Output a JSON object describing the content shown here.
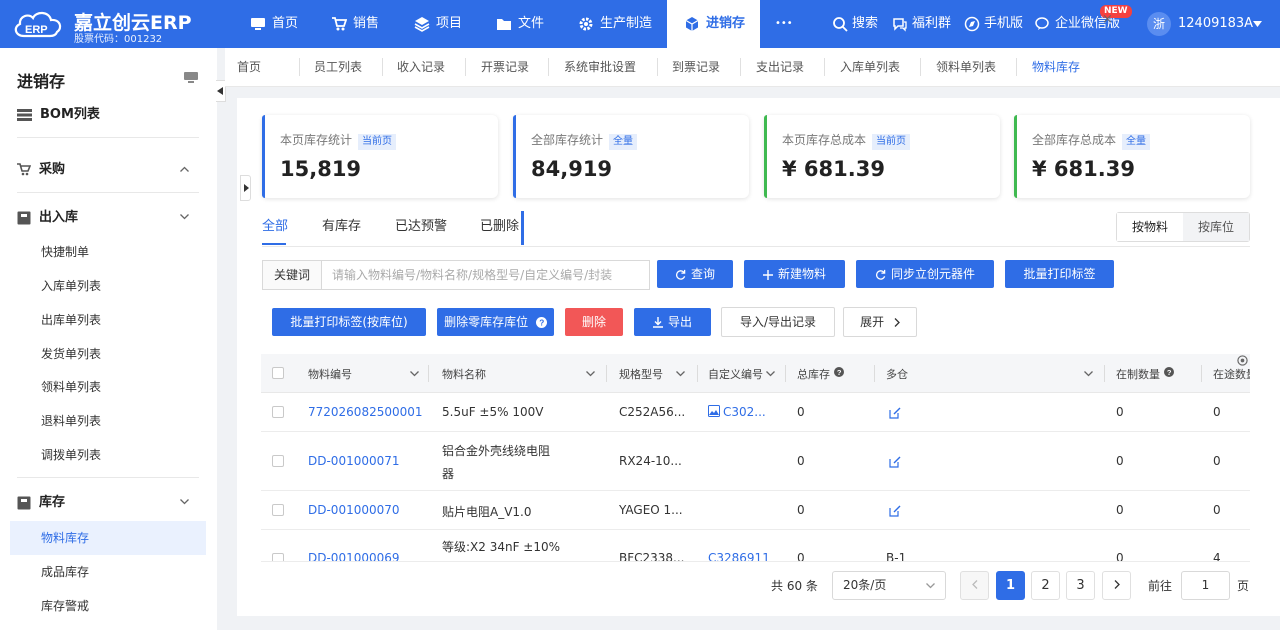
{
  "brand": {
    "name": "嘉立创云ERP",
    "subtitle": "股票代码：001232",
    "logo_text": "ERP"
  },
  "nav": [
    {
      "label": "首页",
      "icon": "monitor-icon"
    },
    {
      "label": "销售",
      "icon": "cart-icon"
    },
    {
      "label": "项目",
      "icon": "layers-icon"
    },
    {
      "label": "文件",
      "icon": "folder-icon"
    },
    {
      "label": "生产制造",
      "icon": "gear-icon"
    },
    {
      "label": "进销存",
      "icon": "cube-icon",
      "active": true
    },
    {
      "label": "•••",
      "icon": "more-icon"
    }
  ],
  "tools": {
    "search": "搜索",
    "welfare": "福利群",
    "mobile": "手机版",
    "wechat": "企业微信版",
    "new_badge": "NEW"
  },
  "user": {
    "avatar": "浙",
    "name": "12409183A"
  },
  "sidebar": {
    "title": "进销存",
    "bom": "BOM列表",
    "purchase": "采购",
    "inout": "出入库",
    "inout_items": [
      "快捷制单",
      "入库单列表",
      "出库单列表",
      "发货单列表",
      "领料单列表",
      "退料单列表",
      "调拨单列表"
    ],
    "stock": "库存",
    "stock_items": [
      "物料库存",
      "成品库存",
      "库存警戒"
    ]
  },
  "tabs": [
    "首页",
    "员工列表",
    "收入记录",
    "开票记录",
    "系统审批设置",
    "到票记录",
    "支出记录",
    "入库单列表",
    "领料单列表",
    "物料库存"
  ],
  "tab_close": "×",
  "cards": [
    {
      "label": "本页库存统计",
      "badge": "当前页",
      "value": "15,819",
      "color": "#2f6de6"
    },
    {
      "label": "全部库存统计",
      "badge": "全量",
      "value": "84,919",
      "color": "#2f6de6"
    },
    {
      "label": "本页库存总成本",
      "badge": "当前页",
      "value": "¥ 681.39",
      "color": "#3fb950"
    },
    {
      "label": "全部库存总成本",
      "badge": "全量",
      "value": "¥ 681.39",
      "color": "#3fb950"
    }
  ],
  "filter_tabs": [
    "全部",
    "有库存",
    "已达预警",
    "已删除"
  ],
  "view_toggle": [
    "按物料",
    "按库位"
  ],
  "search": {
    "label": "关键词",
    "placeholder": "请输入物料编号/物料名称/规格型号/自定义编号/封装"
  },
  "buttons": {
    "query": "查询",
    "new_material": "新建物料",
    "sync": "同步立创元器件",
    "batch_print": "批量打印标签",
    "batch_print_loc": "批量打印标签(按库位)",
    "delete_zero": "删除零库存库位",
    "delete": "删除",
    "export": "导出",
    "import_export": "导入/导出记录",
    "expand": "展开"
  },
  "columns": [
    "物料编号",
    "物料名称",
    "规格型号",
    "自定义编号",
    "总库存",
    "多仓",
    "在制数量",
    "在途数量"
  ],
  "rows": [
    {
      "code": "772026082500001",
      "name": [
        "5.5uF ±5% 100V"
      ],
      "spec": "C252A56...",
      "custom": "C302...",
      "total": "0",
      "multi": "",
      "making": "0",
      "transit": "0"
    },
    {
      "code": "DD-001000071",
      "name": [
        "铝合金外壳线绕电阻",
        "器"
      ],
      "spec": "RX24-10...",
      "custom": "",
      "total": "0",
      "multi": "",
      "making": "0",
      "transit": "0"
    },
    {
      "code": "DD-001000070",
      "name": [
        "贴片电阻A_V1.0"
      ],
      "spec": "YAGEO 1...",
      "custom": "",
      "total": "0",
      "multi": "",
      "making": "0",
      "transit": "0"
    },
    {
      "code": "DD-001000069",
      "name": [
        "等级:X2 34nF ±10%"
      ],
      "spec": "BFC2338...",
      "custom": "C3286911",
      "total": "0",
      "multi": "B-1",
      "making": "0",
      "transit": "4"
    }
  ],
  "pager": {
    "total": "共 60 条",
    "size": "20条/页",
    "pages": [
      "1",
      "2",
      "3"
    ],
    "goto": "前往",
    "goto_value": "1",
    "unit": "页"
  }
}
